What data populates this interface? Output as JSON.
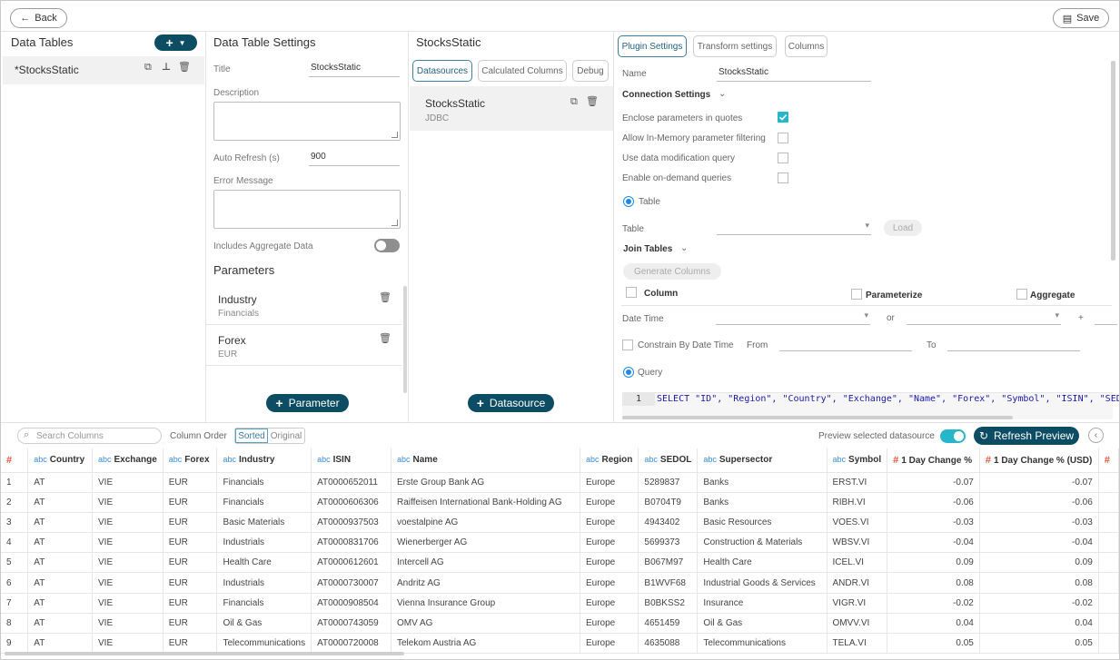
{
  "topbar": {
    "back_label": "Back",
    "save_label": "Save"
  },
  "data_tables": {
    "title": "Data Tables",
    "items": [
      {
        "name": "*StocksStatic"
      }
    ]
  },
  "settings": {
    "title": "Data Table Settings",
    "title_label": "Title",
    "title_value": "StocksStatic",
    "description_label": "Description",
    "auto_refresh_label": "Auto Refresh (s)",
    "auto_refresh_value": "900",
    "error_label": "Error Message",
    "aggregate_label": "Includes Aggregate Data",
    "parameters_title": "Parameters",
    "parameters": [
      {
        "name": "Industry",
        "value": "Financials"
      },
      {
        "name": "Forex",
        "value": "EUR"
      }
    ],
    "add_parameter_label": "Parameter"
  },
  "datasources": {
    "title": "StocksStatic",
    "tabs": [
      "Datasources",
      "Calculated Columns",
      "Debug"
    ],
    "items": [
      {
        "name": "StocksStatic",
        "type": "JDBC"
      }
    ],
    "add_label": "Datasource"
  },
  "plugin": {
    "tabs": [
      "Plugin Settings",
      "Transform settings",
      "Columns"
    ],
    "name_label": "Name",
    "name_value": "StocksStatic",
    "connection_settings": "Connection Settings",
    "options": [
      {
        "label": "Enclose parameters in quotes",
        "checked": true
      },
      {
        "label": "Allow In-Memory parameter filtering",
        "checked": false
      },
      {
        "label": "Use data modification query",
        "checked": false
      },
      {
        "label": "Enable on-demand queries",
        "checked": false
      }
    ],
    "table_radio": "Table",
    "table_label": "Table",
    "load_label": "Load",
    "join_tables": "Join Tables",
    "generate_columns": "Generate Columns",
    "col_header": "Column",
    "param_header": "Parameterize",
    "agg_header": "Aggregate",
    "datetime_label": "Date Time",
    "or_label": "or",
    "plus_label": "+",
    "constrain_label": "Constrain By Date Time",
    "from_label": "From",
    "to_label": "To",
    "query_radio": "Query",
    "query_line_no": "1",
    "query_text": "SELECT \"ID\", \"Region\", \"Country\", \"Exchange\", \"Name\", \"Forex\", \"Symbol\", \"ISIN\", \"SEDOL\","
  },
  "preview": {
    "search_placeholder": "Search Columns",
    "column_order_label": "Column Order",
    "sorted_label": "Sorted",
    "original_label": "Original",
    "preview_label": "Preview selected datasource",
    "refresh_label": "Refresh Preview",
    "columns": [
      {
        "type": "#",
        "name": ""
      },
      {
        "type": "abc",
        "name": "Country"
      },
      {
        "type": "abc",
        "name": "Exchange"
      },
      {
        "type": "abc",
        "name": "Forex"
      },
      {
        "type": "abc",
        "name": "Industry"
      },
      {
        "type": "abc",
        "name": "ISIN"
      },
      {
        "type": "abc",
        "name": "Name"
      },
      {
        "type": "abc",
        "name": "Region"
      },
      {
        "type": "abc",
        "name": "SEDOL"
      },
      {
        "type": "abc",
        "name": "Supersector"
      },
      {
        "type": "abc",
        "name": "Symbol"
      },
      {
        "type": "#",
        "name": "1 Day Change %"
      },
      {
        "type": "#",
        "name": "1 Day Change % (USD)"
      },
      {
        "type": "#",
        "name": ""
      }
    ],
    "rows": [
      [
        "1",
        "AT",
        "VIE",
        "EUR",
        "Financials",
        "AT0000652011",
        "Erste Group Bank AG",
        "Europe",
        "5289837",
        "Banks",
        "ERST.VI",
        "-0.07",
        "-0.07",
        ""
      ],
      [
        "2",
        "AT",
        "VIE",
        "EUR",
        "Financials",
        "AT0000606306",
        "Raiffeisen International Bank-Holding AG",
        "Europe",
        "B0704T9",
        "Banks",
        "RIBH.VI",
        "-0.06",
        "-0.06",
        ""
      ],
      [
        "3",
        "AT",
        "VIE",
        "EUR",
        "Basic Materials",
        "AT0000937503",
        "voestalpine AG",
        "Europe",
        "4943402",
        "Basic Resources",
        "VOES.VI",
        "-0.03",
        "-0.03",
        ""
      ],
      [
        "4",
        "AT",
        "VIE",
        "EUR",
        "Industrials",
        "AT0000831706",
        "Wienerberger AG",
        "Europe",
        "5699373",
        "Construction & Materials",
        "WBSV.VI",
        "-0.04",
        "-0.04",
        ""
      ],
      [
        "5",
        "AT",
        "VIE",
        "EUR",
        "Health Care",
        "AT0000612601",
        "Intercell AG",
        "Europe",
        "B067M97",
        "Health Care",
        "ICEL.VI",
        "0.09",
        "0.09",
        ""
      ],
      [
        "6",
        "AT",
        "VIE",
        "EUR",
        "Industrials",
        "AT0000730007",
        "Andritz AG",
        "Europe",
        "B1WVF68",
        "Industrial Goods & Services",
        "ANDR.VI",
        "0.08",
        "0.08",
        ""
      ],
      [
        "7",
        "AT",
        "VIE",
        "EUR",
        "Financials",
        "AT0000908504",
        "Vienna Insurance Group",
        "Europe",
        "B0BKSS2",
        "Insurance",
        "VIGR.VI",
        "-0.02",
        "-0.02",
        ""
      ],
      [
        "8",
        "AT",
        "VIE",
        "EUR",
        "Oil & Gas",
        "AT0000743059",
        "OMV AG",
        "Europe",
        "4651459",
        "Oil & Gas",
        "OMVV.VI",
        "0.04",
        "0.04",
        ""
      ],
      [
        "9",
        "AT",
        "VIE",
        "EUR",
        "Telecommunications",
        "AT0000720008",
        "Telekom Austria AG",
        "Europe",
        "4635088",
        "Telecommunications",
        "TELA.VI",
        "0.05",
        "0.05",
        ""
      ]
    ]
  },
  "colors": {
    "accent": "#0d4d63",
    "toggle_on": "#26b5c9",
    "check": "#26b5c9",
    "radio": "#1e88e5"
  }
}
